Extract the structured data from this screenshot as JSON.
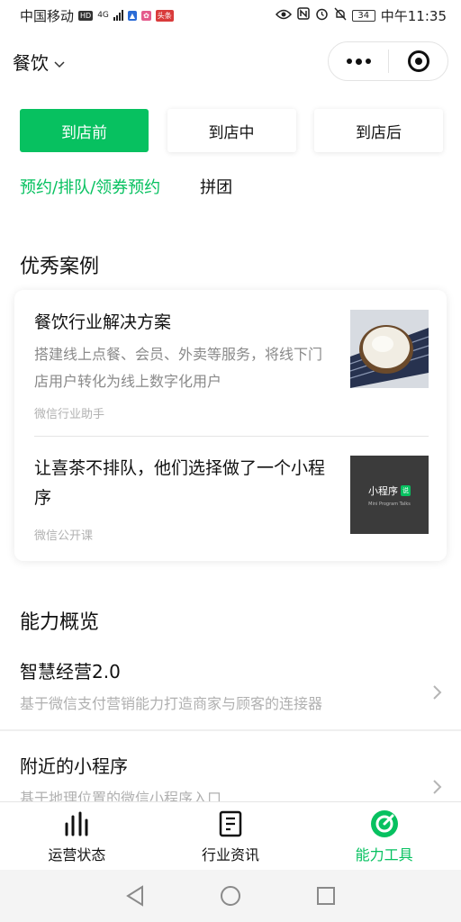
{
  "status_bar": {
    "carrier": "中国移动",
    "hd_badge": "HD",
    "network": "4G",
    "time": "中午11:35",
    "battery": "34",
    "toutiao_badge": "头条"
  },
  "header": {
    "title": "餐饮",
    "dropdown_icon": "chevron-down-icon"
  },
  "stages": [
    {
      "label": "到店前",
      "active": true
    },
    {
      "label": "到店中",
      "active": false
    },
    {
      "label": "到店后",
      "active": false
    }
  ],
  "subtabs": [
    {
      "label": "预约/排队/领券预约",
      "active": true
    },
    {
      "label": "拼团",
      "active": false
    }
  ],
  "cases": {
    "title": "优秀案例",
    "items": [
      {
        "title": "餐饮行业解决方案",
        "description": "搭建线上点餐、会员、外卖等服务，将线下门店用户转化为线上数字化用户",
        "source": "微信行业助手",
        "thumbnail": "rice-bowl-image"
      },
      {
        "title": "让喜茶不排队，他们选择做了一个小程序",
        "description": "",
        "source": "微信公开课",
        "thumbnail": {
          "main": "小程序",
          "badge": "说",
          "sub": "Mini Program Talks"
        }
      }
    ]
  },
  "capabilities": {
    "title": "能力概览",
    "items": [
      {
        "title": "智慧经营2.0",
        "description": "基于微信支付营销能力打造商家与顾客的连接器"
      },
      {
        "title": "附近的小程序",
        "description": "基于地理位置的微信小程序入口"
      }
    ]
  },
  "tabbar": [
    {
      "label": "运营状态",
      "icon": "bar-chart-icon",
      "active": false
    },
    {
      "label": "行业资讯",
      "icon": "document-icon",
      "active": false
    },
    {
      "label": "能力工具",
      "icon": "target-icon",
      "active": true
    }
  ],
  "colors": {
    "accent": "#07c160",
    "muted_text": "#8a8a8a",
    "border": "#e5e5e5"
  }
}
